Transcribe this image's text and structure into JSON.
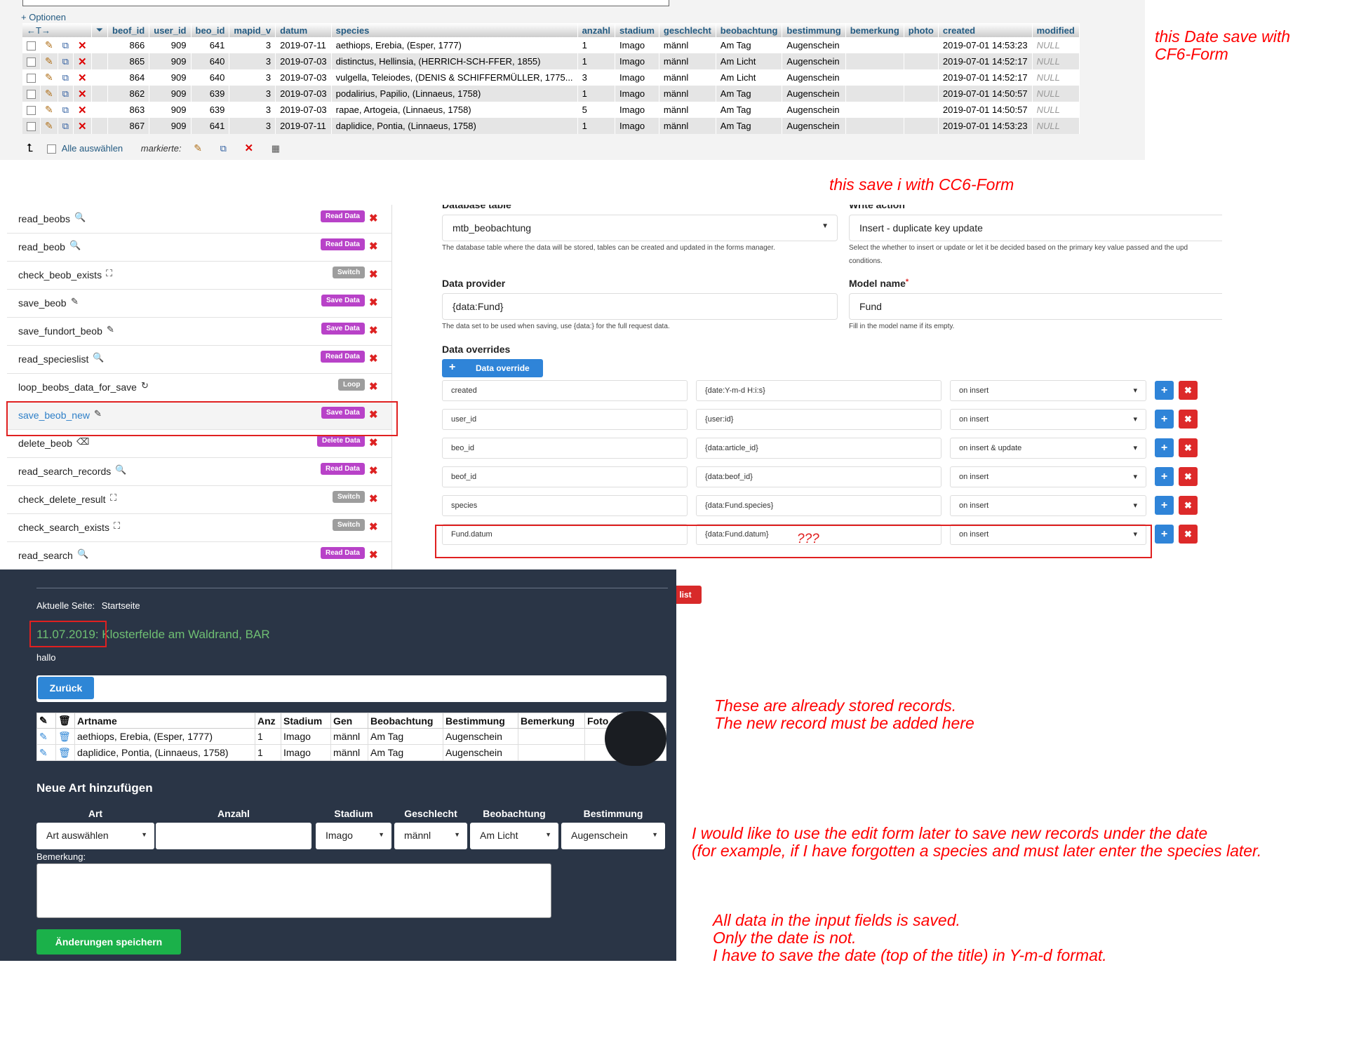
{
  "pma": {
    "optionen": "+ Optionen",
    "sort_arrows": "←T→",
    "columns": [
      "beof_id",
      "user_id",
      "beo_id",
      "mapid_v",
      "datum",
      "species",
      "anzahl",
      "stadium",
      "geschlecht",
      "beobachtung",
      "bestimmung",
      "bemerkung",
      "photo",
      "created",
      "modified"
    ],
    "rows": [
      [
        "866",
        "909",
        "641",
        "3",
        "2019-07-11",
        "aethiops, Erebia, (Esper, 1777)",
        "1",
        "Imago",
        "männl",
        "Am Tag",
        "Augenschein",
        "",
        "",
        "2019-07-01 14:53:23",
        "NULL"
      ],
      [
        "865",
        "909",
        "640",
        "3",
        "2019-07-03",
        "distinctus, Hellinsia, (HERRICH-SCH-FFER, 1855)",
        "1",
        "Imago",
        "männl",
        "Am Licht",
        "Augenschein",
        "",
        "",
        "2019-07-01 14:52:17",
        "NULL"
      ],
      [
        "864",
        "909",
        "640",
        "3",
        "2019-07-03",
        "vulgella, Teleiodes, (DENIS & SCHIFFERMÜLLER, 1775...",
        "3",
        "Imago",
        "männl",
        "Am Licht",
        "Augenschein",
        "",
        "",
        "2019-07-01 14:52:17",
        "NULL"
      ],
      [
        "862",
        "909",
        "639",
        "3",
        "2019-07-03",
        "podalirius, Papilio, (Linnaeus, 1758)",
        "1",
        "Imago",
        "männl",
        "Am Tag",
        "Augenschein",
        "",
        "",
        "2019-07-01 14:50:57",
        "NULL"
      ],
      [
        "863",
        "909",
        "639",
        "3",
        "2019-07-03",
        "rapae, Artogeia, (Linnaeus, 1758)",
        "5",
        "Imago",
        "männl",
        "Am Tag",
        "Augenschein",
        "",
        "",
        "2019-07-01 14:50:57",
        "NULL"
      ],
      [
        "867",
        "909",
        "641",
        "3",
        "2019-07-11",
        "daplidice, Pontia, (Linnaeus, 1758)",
        "1",
        "Imago",
        "männl",
        "Am Tag",
        "Augenschein",
        "",
        "",
        "2019-07-01 14:53:23",
        "NULL"
      ]
    ],
    "select_all": "Alle auswählen",
    "markierte": "markierte:"
  },
  "annotations": {
    "cf6": "this Date save with\nCF6-Form",
    "cc6": "this save i with CC6-Form",
    "stored": "These are already stored records.\nThe new record must be added here",
    "edit_form": "I would like to use the edit form later to save new records under the date\n(for example, if I have forgotten a species and must later enter the species later.",
    "date": "All data in the input fields is saved.\nOnly the date is not.\nI have to save the date (top of the title) in Y-m-d format.",
    "qqq": "???"
  },
  "cf_list": [
    {
      "name": "read_beobs",
      "icon": "search-icon",
      "badge": "Read Data",
      "kind": "read"
    },
    {
      "name": "read_beob",
      "icon": "search-icon",
      "badge": "Read Data",
      "kind": "read"
    },
    {
      "name": "check_beob_exists",
      "icon": "sitemap-icon",
      "badge": "Switch",
      "kind": "switch"
    },
    {
      "name": "save_beob",
      "icon": "pencil-icon",
      "badge": "Save Data",
      "kind": "save"
    },
    {
      "name": "save_fundort_beob",
      "icon": "pencil-icon",
      "badge": "Save Data",
      "kind": "save"
    },
    {
      "name": "read_specieslist",
      "icon": "search-icon",
      "badge": "Read Data",
      "kind": "read"
    },
    {
      "name": "loop_beobs_data_for_save",
      "icon": "loop-icon",
      "badge": "Loop",
      "kind": "loop"
    },
    {
      "name": "save_beob_new",
      "icon": "pencil-icon",
      "badge": "Save Data",
      "kind": "save"
    },
    {
      "name": "delete_beob",
      "icon": "eraser-icon",
      "badge": "Delete Data",
      "kind": "delete"
    },
    {
      "name": "read_search_records",
      "icon": "search-icon",
      "badge": "Read Data",
      "kind": "read"
    },
    {
      "name": "check_delete_result",
      "icon": "sitemap-icon",
      "badge": "Switch",
      "kind": "switch"
    },
    {
      "name": "check_search_exists",
      "icon": "sitemap-icon",
      "badge": "Switch",
      "kind": "switch"
    },
    {
      "name": "read_search",
      "icon": "search-icon",
      "badge": "Read Data",
      "kind": "read"
    }
  ],
  "cf_form": {
    "db_table_label": "Database table",
    "db_table_value": "mtb_beobachtung",
    "db_table_help": "The database table where the data will be stored, tables can be created and updated in the forms manager.",
    "write_action_label": "Write action",
    "write_action_value": "Insert - duplicate key update",
    "write_action_help": "Select the whether to insert or update or let it be decided based on the primary key value passed and the upd",
    "write_action_help2": "conditions.",
    "provider_label": "Data provider",
    "provider_value": "{data:Fund}",
    "provider_help": "The data set to be used when saving, use {data:} for the full request data.",
    "model_label": "Model name",
    "model_required": "*",
    "model_value": "Fund",
    "model_help": "Fill in the model name if its empty.",
    "overrides_label": "Data overrides",
    "override_button": "Data override",
    "overrides": [
      {
        "field": "created",
        "value": "{date:Y-m-d H:i:s}",
        "mode": "on insert"
      },
      {
        "field": "user_id",
        "value": "{user:id}",
        "mode": "on insert"
      },
      {
        "field": "beo_id",
        "value": "{data:article_id}",
        "mode": "on insert & update"
      },
      {
        "field": "beof_id",
        "value": "{data:beof_id}",
        "mode": "on insert"
      },
      {
        "field": "species",
        "value": "{data:Fund.species}",
        "mode": "on insert"
      },
      {
        "field": "Fund.datum",
        "value": "{data:Fund.datum}",
        "mode": "on insert"
      }
    ]
  },
  "list_button": "list",
  "frontend": {
    "crumb_label": "Aktuelle Seite:",
    "crumb_value": "Startseite",
    "title_date": "11.07.2019:",
    "title_rest": " Klosterfelde am Waldrand, BAR",
    "hallo": "hallo",
    "back_button": "Zurück",
    "columns": [
      "Artname",
      "Anz",
      "Stadium",
      "Gen",
      "Beobachtung",
      "Bestimmung",
      "Bemerkung",
      "Foto"
    ],
    "rows": [
      [
        "aethiops, Erebia, (Esper, 1777)",
        "1",
        "Imago",
        "männl",
        "Am Tag",
        "Augenschein",
        "",
        ""
      ],
      [
        "daplidice, Pontia, (Linnaeus, 1758)",
        "1",
        "Imago",
        "männl",
        "Am Tag",
        "Augenschein",
        "",
        ""
      ]
    ],
    "new_heading": "Neue Art hinzufügen",
    "field_labels": [
      "Art",
      "Anzahl",
      "Stadium",
      "Geschlecht",
      "Beobachtung",
      "Bestimmung"
    ],
    "field_values": [
      "Art auswählen",
      "",
      "Imago",
      "männl",
      "Am Licht",
      "Augenschein"
    ],
    "remark_label": "Bemerkung:",
    "save_button": "Änderungen speichern"
  }
}
